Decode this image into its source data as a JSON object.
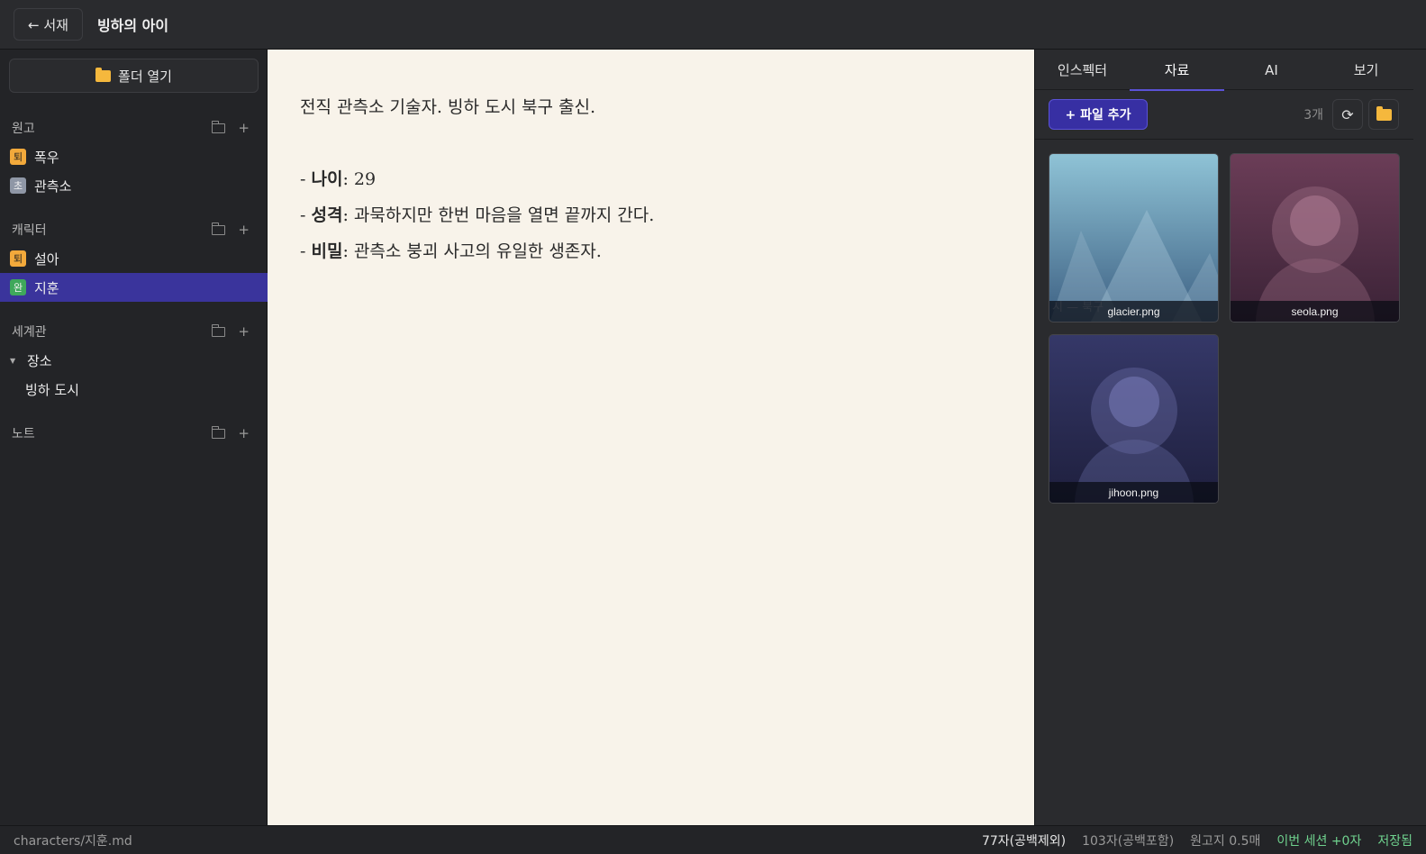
{
  "topbar": {
    "back_label": "← 서재",
    "title": "빙하의 아이"
  },
  "sidebar": {
    "open_folder_label": "폴더 열기",
    "sections": [
      {
        "title": "원고",
        "items": [
          {
            "badge": "퇴",
            "label": "폭우"
          },
          {
            "badge": "초",
            "label": "관측소"
          }
        ]
      },
      {
        "title": "캐릭터",
        "items": [
          {
            "badge": "퇴",
            "label": "설아"
          },
          {
            "badge": "완",
            "label": "지훈"
          }
        ]
      },
      {
        "title": "세계관",
        "folder": "장소",
        "child": "빙하 도시"
      },
      {
        "title": "노트"
      }
    ]
  },
  "editor": {
    "intro": "전직 관측소 기술자. 빙하 도시 북구 출신.",
    "fields": [
      {
        "key": "나이",
        "value": ": 29"
      },
      {
        "key": "성격",
        "value": ": 과묵하지만 한번 마음을 열면 끝까지 간다."
      },
      {
        "key": "비밀",
        "value": ": 관측소 붕괴 사고의 유일한 생존자."
      }
    ]
  },
  "right_panel": {
    "tabs": [
      "인스펙터",
      "자료",
      "AI",
      "보기"
    ],
    "active_tab": "자료",
    "add_file_label": "+ 파일 추가",
    "count": "3개",
    "files": [
      {
        "name": "glacier.png",
        "overlay": "시 — 북구"
      },
      {
        "name": "seola.png"
      },
      {
        "name": "jihoon.png"
      }
    ]
  },
  "statusbar": {
    "path": "characters/지훈.md",
    "chars_no_space": "77자(공백제외)",
    "chars_with_space": "103자(공백포함)",
    "manuscript_pages": "원고지 0.5매",
    "session": "이번 세션 +0자",
    "saved": "저장됨"
  },
  "colors": {
    "accent": "#3a349c",
    "editor_bg": "#f8f3ea",
    "status_green": "#6fd28e",
    "folder_yellow": "#f5b83d"
  }
}
